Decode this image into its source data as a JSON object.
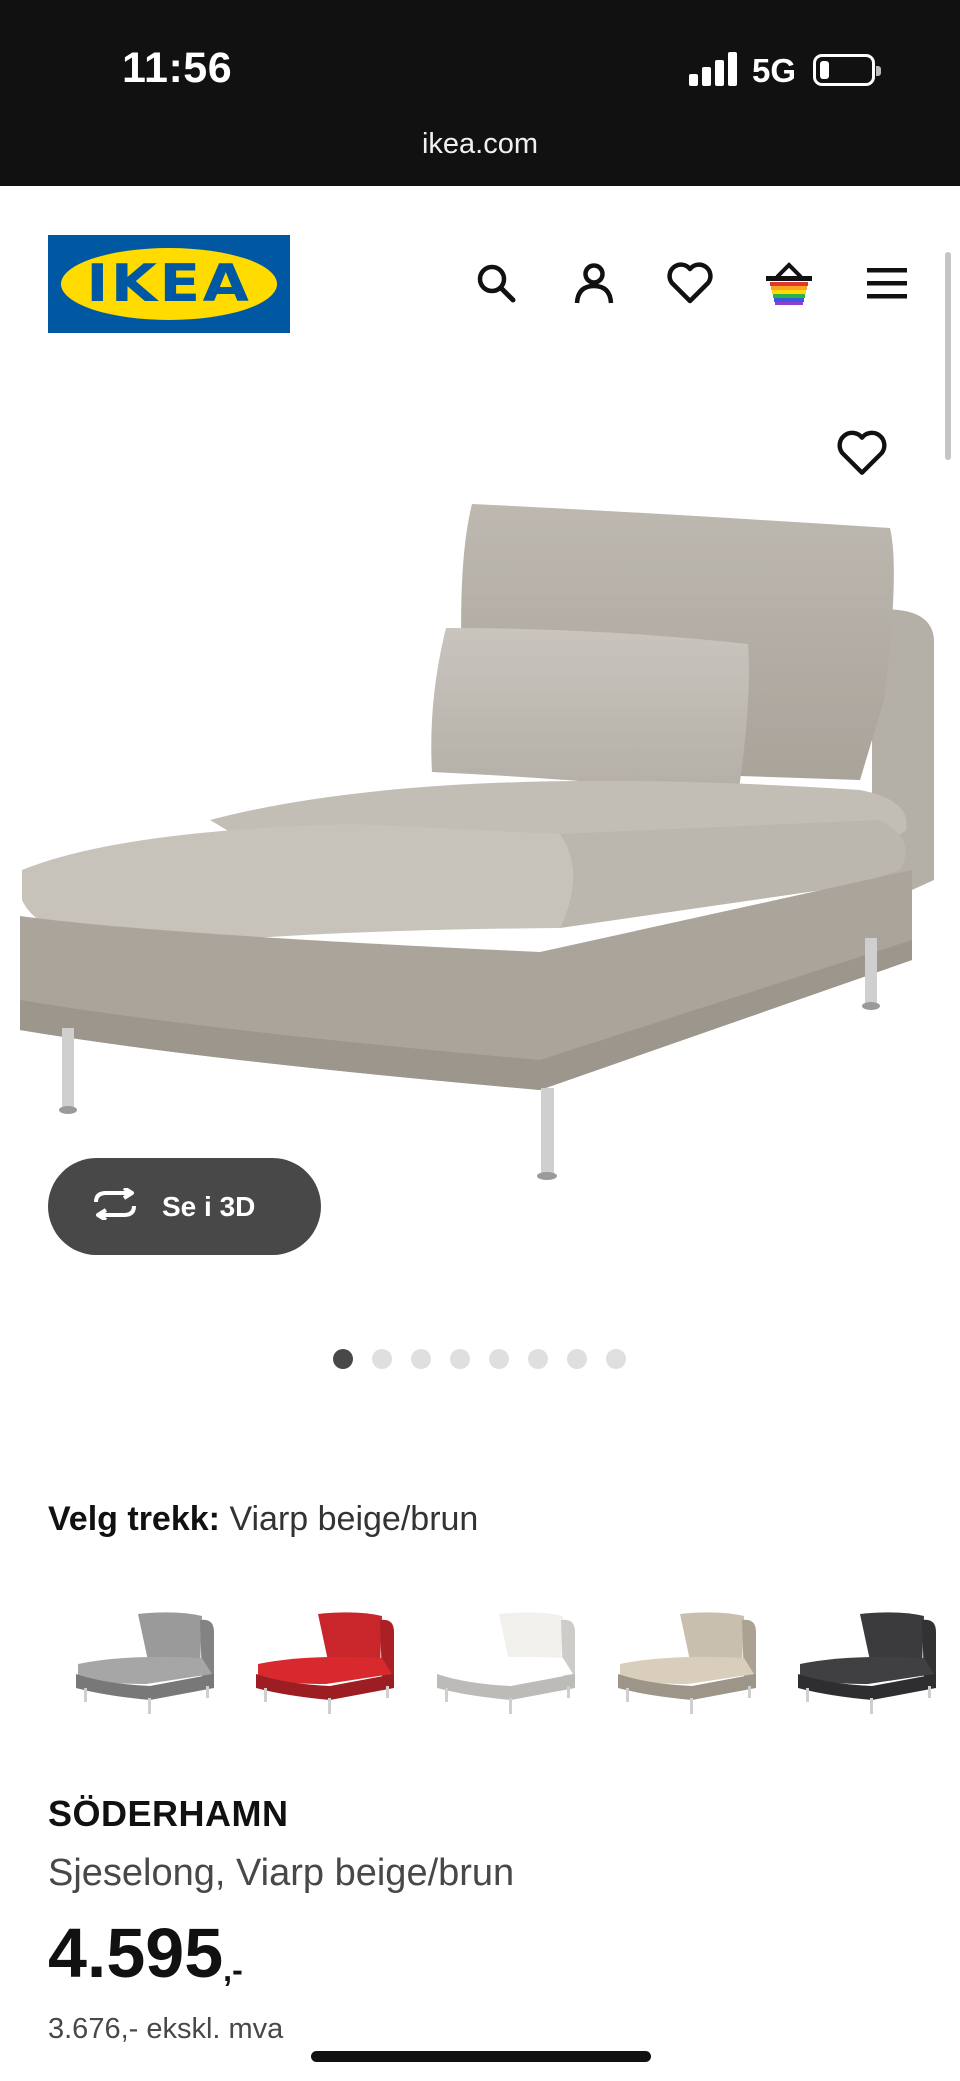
{
  "status_bar": {
    "time": "11:56",
    "network": "5G"
  },
  "browser": {
    "url": "ikea.com"
  },
  "header": {
    "logo_text": "IKEA"
  },
  "gallery": {
    "button_3d_label": "Se i 3D",
    "dot_count": 8,
    "active_dot": 1
  },
  "variant": {
    "label": "Velg trekk:",
    "value": "Viarp beige/brun",
    "swatches": [
      {
        "color": "#9a9a9a",
        "name": "grey"
      },
      {
        "color": "#c8262b",
        "name": "red"
      },
      {
        "color": "#f1f0ec",
        "name": "white"
      },
      {
        "color": "#c9bfae",
        "name": "beige"
      },
      {
        "color": "#3b3b3d",
        "name": "dark-grey"
      }
    ]
  },
  "product": {
    "name": "SÖDERHAMN",
    "description": "Sjeselong, Viarp beige/brun",
    "price": "4.595",
    "price_suffix": ",-",
    "price_ex_vat": "3.676,- ekskl. mva"
  },
  "colors": {
    "ikea_blue": "#0058a3",
    "ikea_yellow": "#ffdb00",
    "button_dark": "#484848"
  }
}
